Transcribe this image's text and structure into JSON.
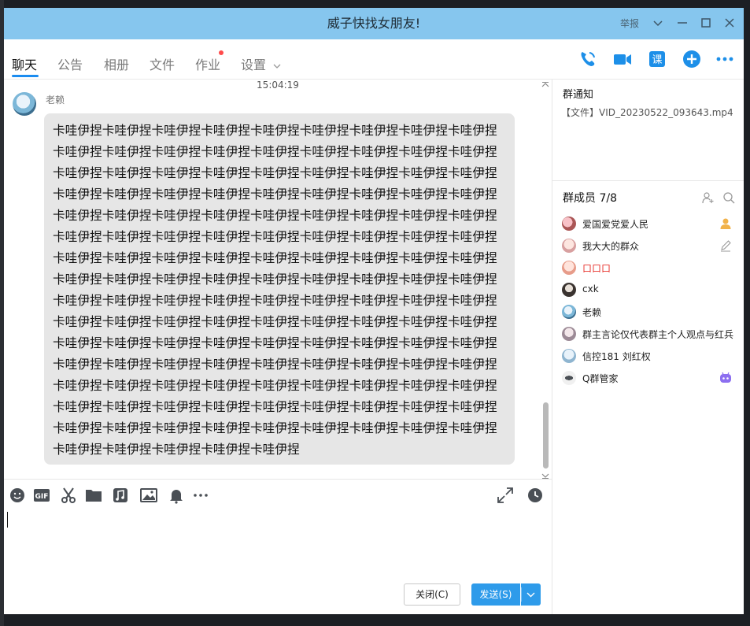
{
  "window": {
    "title": "威子快找女朋友!",
    "report_label": "举报"
  },
  "tabs": [
    {
      "label": "聊天",
      "active": true
    },
    {
      "label": "公告",
      "active": false
    },
    {
      "label": "相册",
      "active": false
    },
    {
      "label": "文件",
      "active": false
    },
    {
      "label": "作业",
      "active": false,
      "badge": "red-dot"
    },
    {
      "label": "设置",
      "active": false,
      "dropdown": true
    }
  ],
  "nav_icons": [
    "phone-icon",
    "video-icon",
    "class-icon",
    "add-icon",
    "more-icon"
  ],
  "class_icon_text": "课",
  "chat": {
    "timestamp": "15:04:19",
    "sender": "老赖",
    "message_lines": [
      "卡哇伊捏卡哇伊捏卡哇伊捏卡哇伊捏卡哇伊捏卡哇伊捏卡哇伊捏卡哇伊捏卡哇伊捏",
      "卡哇伊捏卡哇伊捏卡哇伊捏卡哇伊捏卡哇伊捏卡哇伊捏卡哇伊捏卡哇伊捏卡哇伊捏",
      "卡哇伊捏卡哇伊捏卡哇伊捏卡哇伊捏卡哇伊捏卡哇伊捏卡哇伊捏卡哇伊捏卡哇伊捏",
      "卡哇伊捏卡哇伊捏卡哇伊捏卡哇伊捏卡哇伊捏卡哇伊捏卡哇伊捏卡哇伊捏卡哇伊捏",
      "卡哇伊捏卡哇伊捏卡哇伊捏卡哇伊捏卡哇伊捏卡哇伊捏卡哇伊捏卡哇伊捏卡哇伊捏",
      "卡哇伊捏卡哇伊捏卡哇伊捏卡哇伊捏卡哇伊捏卡哇伊捏卡哇伊捏卡哇伊捏卡哇伊捏",
      "卡哇伊捏卡哇伊捏卡哇伊捏卡哇伊捏卡哇伊捏卡哇伊捏卡哇伊捏卡哇伊捏卡哇伊捏",
      "卡哇伊捏卡哇伊捏卡哇伊捏卡哇伊捏卡哇伊捏卡哇伊捏卡哇伊捏卡哇伊捏卡哇伊捏",
      "卡哇伊捏卡哇伊捏卡哇伊捏卡哇伊捏卡哇伊捏卡哇伊捏卡哇伊捏卡哇伊捏卡哇伊捏",
      "卡哇伊捏卡哇伊捏卡哇伊捏卡哇伊捏卡哇伊捏卡哇伊捏卡哇伊捏卡哇伊捏卡哇伊捏",
      "卡哇伊捏卡哇伊捏卡哇伊捏卡哇伊捏卡哇伊捏卡哇伊捏卡哇伊捏卡哇伊捏卡哇伊捏",
      "卡哇伊捏卡哇伊捏卡哇伊捏卡哇伊捏卡哇伊捏卡哇伊捏卡哇伊捏卡哇伊捏卡哇伊捏",
      "卡哇伊捏卡哇伊捏卡哇伊捏卡哇伊捏卡哇伊捏卡哇伊捏卡哇伊捏卡哇伊捏卡哇伊捏",
      "卡哇伊捏卡哇伊捏卡哇伊捏卡哇伊捏卡哇伊捏卡哇伊捏卡哇伊捏卡哇伊捏卡哇伊捏",
      "卡哇伊捏卡哇伊捏卡哇伊捏卡哇伊捏卡哇伊捏卡哇伊捏卡哇伊捏卡哇伊捏卡哇伊捏",
      "卡哇伊捏卡哇伊捏卡哇伊捏卡哇伊捏卡哇伊捏"
    ]
  },
  "toolbar_icons": [
    "emoji-icon",
    "gif-icon",
    "scissors-icon",
    "folder-icon",
    "music-icon",
    "image-icon",
    "bell-icon",
    "more-icon",
    "expand-icon",
    "history-icon"
  ],
  "toolbar_gif_text": "GIF",
  "buttons": {
    "close_label": "关闭(C)",
    "send_label": "发送(S)"
  },
  "notice": {
    "title": "群通知",
    "body": "【文件】VID_20230522_093643.mp4"
  },
  "members": {
    "title": "群成员 7/8",
    "list": [
      {
        "name": "爱国爱党爱人民",
        "tag": "owner-icon",
        "highlight": false
      },
      {
        "name": "我大大的群众",
        "tag": "edit-icon",
        "highlight": false
      },
      {
        "name": "口口口",
        "tag": "",
        "highlight": true
      },
      {
        "name": "cxk",
        "tag": "",
        "highlight": false
      },
      {
        "name": "老赖",
        "tag": "",
        "highlight": false
      },
      {
        "name": "群主言论仅代表群主个人观点与红兵",
        "tag": "",
        "highlight": false
      },
      {
        "name": "信控181 刘红权",
        "tag": "",
        "highlight": false
      },
      {
        "name": "Q群管家",
        "tag": "bot-icon",
        "highlight": false
      }
    ]
  },
  "colors": {
    "titlebar": "#86c6ee",
    "accent": "#2e9bea",
    "bubble": "#e6e6e6",
    "highlight_name": "#e8322b"
  }
}
